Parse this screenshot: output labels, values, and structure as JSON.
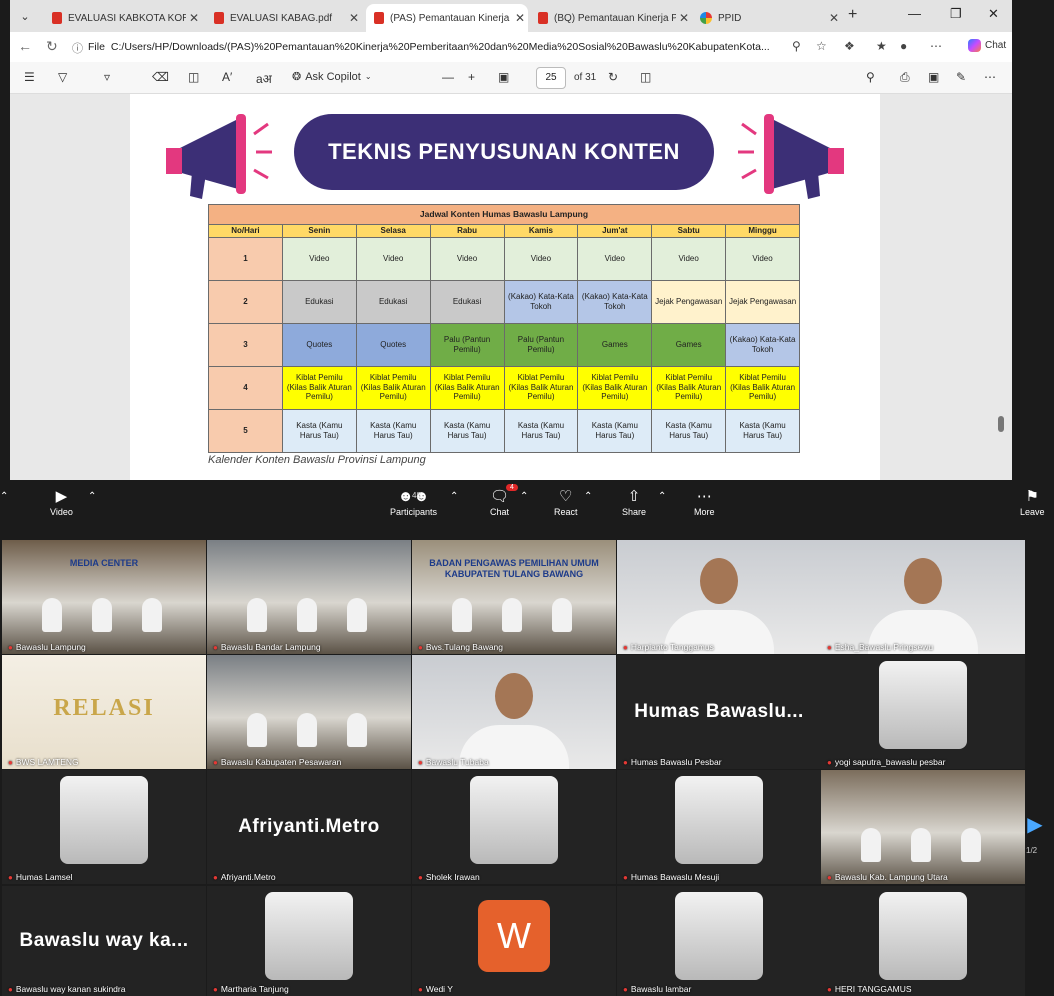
{
  "browser": {
    "tabs": [
      {
        "label": "EVALUASI KABKOTA KORDIN",
        "type": "pdf"
      },
      {
        "label": "EVALUASI KABAG.pdf",
        "type": "pdf"
      },
      {
        "label": "(PAS) Pemantauan Kinerja Pe",
        "type": "pdf",
        "active": true
      },
      {
        "label": "(BQ) Pemantauan Kinerja Pe",
        "type": "pdf"
      },
      {
        "label": "PPID",
        "type": "site"
      }
    ],
    "address_label": "File",
    "url": "C:/Users/HP/Downloads/(PAS)%20Pemantauan%20Kinerja%20Pemberitaan%20dan%20Media%20Sosial%20Bawaslu%20KabupatenKota...",
    "chat_label": "Chat",
    "toolbar": {
      "ask_copilot": "Ask Copilot",
      "page_current": "25",
      "page_total": "of 31"
    }
  },
  "pdf_page": {
    "banner_title": "TEKNIS PENYUSUNAN KONTEN",
    "table_title": "Jadwal Konten Humas Bawaslu Lampung",
    "col_headers": [
      "No/Hari",
      "Senin",
      "Selasa",
      "Rabu",
      "Kamis",
      "Jum'at",
      "Sabtu",
      "Minggu"
    ],
    "rows": [
      {
        "no": "1",
        "cells": [
          "Video",
          "Video",
          "Video",
          "Video",
          "Video",
          "Video",
          "Video"
        ],
        "colors": [
          "#e2efda",
          "#e2efda",
          "#e2efda",
          "#e2efda",
          "#e2efda",
          "#e2efda",
          "#e2efda"
        ]
      },
      {
        "no": "2",
        "cells": [
          "Edukasi",
          "Edukasi",
          "Edukasi",
          "(Kakao) Kata-Kata Tokoh",
          "(Kakao) Kata-Kata Tokoh",
          "Jejak Pengawasan",
          "Jejak Pengawasan"
        ],
        "colors": [
          "#c9c9c9",
          "#c9c9c9",
          "#c9c9c9",
          "#b4c6e7",
          "#b4c6e7",
          "#fff2cc",
          "#fff2cc"
        ]
      },
      {
        "no": "3",
        "cells": [
          "Quotes",
          "Quotes",
          "Palu (Pantun Pemilu)",
          "Palu (Pantun Pemilu)",
          "Games",
          "Games",
          "(Kakao) Kata-Kata Tokoh"
        ],
        "colors": [
          "#8eaadb",
          "#8eaadb",
          "#70ad47",
          "#70ad47",
          "#70ad47",
          "#70ad47",
          "#b4c6e7"
        ]
      },
      {
        "no": "4",
        "cells": [
          "Kiblat Pemilu (Kilas Balik Aturan Pemilu)",
          "Kiblat Pemilu (Kilas Balik Aturan Pemilu)",
          "Kiblat Pemilu (Kilas Balik Aturan Pemilu)",
          "Kiblat Pemilu (Kilas Balik Aturan Pemilu)",
          "Kiblat Pemilu (Kilas Balik Aturan Pemilu)",
          "Kiblat Pemilu (Kilas Balik Aturan Pemilu)",
          "Kiblat Pemilu (Kilas Balik Aturan Pemilu)"
        ],
        "colors": [
          "#ffff00",
          "#ffff00",
          "#ffff00",
          "#ffff00",
          "#ffff00",
          "#ffff00",
          "#ffff00"
        ]
      },
      {
        "no": "5",
        "cells": [
          "Kasta (Kamu Harus Tau)",
          "Kasta (Kamu Harus Tau)",
          "Kasta (Kamu Harus Tau)",
          "Kasta (Kamu Harus Tau)",
          "Kasta (Kamu Harus Tau)",
          "Kasta (Kamu Harus Tau)",
          "Kasta (Kamu Harus Tau)"
        ],
        "colors": [
          "#ddebf7",
          "#ddebf7",
          "#ddebf7",
          "#ddebf7",
          "#ddebf7",
          "#ddebf7",
          "#ddebf7"
        ]
      }
    ],
    "caption": "Kalender Konten Bawaslu Provinsi Lampung"
  },
  "zoom_controls": {
    "video": "Video",
    "participants": "Participants",
    "participants_count": "48",
    "chat": "Chat",
    "chat_badge": "4",
    "react": "React",
    "share": "Share",
    "more": "More",
    "leave": "Leave"
  },
  "participants": [
    {
      "name": "Bawaslu Lampung",
      "kind": "room",
      "scene_text": "MEDIA CENTER"
    },
    {
      "name": "Bawaslu Bandar Lampung",
      "kind": "room"
    },
    {
      "name": "Bws.Tulang Bawang",
      "kind": "room",
      "scene_text": "BADAN PENGAWAS PEMILIHAN UMUM KABUPATEN TULANG BAWANG"
    },
    {
      "name": "Harpianto Tanggamus",
      "kind": "person"
    },
    {
      "name": "Esha_Bawaslu Pringsewu",
      "kind": "person"
    },
    {
      "name": "BWS LAMTENG",
      "kind": "logo",
      "scene_text": "RELASI"
    },
    {
      "name": "Bawaslu Kabupaten Pesawaran",
      "kind": "room"
    },
    {
      "name": "Bawaslu Tubaba",
      "kind": "person"
    },
    {
      "name": "Humas Bawaslu Pesbar",
      "kind": "text",
      "display": "Humas  Bawaslu..."
    },
    {
      "name": "yogi saputra_bawaslu pesbar",
      "kind": "avatar"
    },
    {
      "name": "Humas Lamsel",
      "kind": "avatar"
    },
    {
      "name": "Afriyanti.Metro",
      "kind": "text",
      "display": "Afriyanti.Metro"
    },
    {
      "name": "Sholek Irawan",
      "kind": "avatar"
    },
    {
      "name": "Humas Bawaslu Mesuji",
      "kind": "avatar"
    },
    {
      "name": "Bawaslu Kab. Lampung Utara",
      "kind": "room"
    },
    {
      "name": "Bawaslu way kanan sukindra",
      "kind": "text",
      "display": "Bawaslu  way  ka..."
    },
    {
      "name": "Martharia Tanjung",
      "kind": "avatar"
    },
    {
      "name": "Wedi Y",
      "kind": "letter",
      "display": "W"
    },
    {
      "name": "Bawaslu lambar",
      "kind": "avatar"
    },
    {
      "name": "HERI TANGGAMUS",
      "kind": "avatar"
    }
  ],
  "pager": {
    "label": "1/2"
  }
}
